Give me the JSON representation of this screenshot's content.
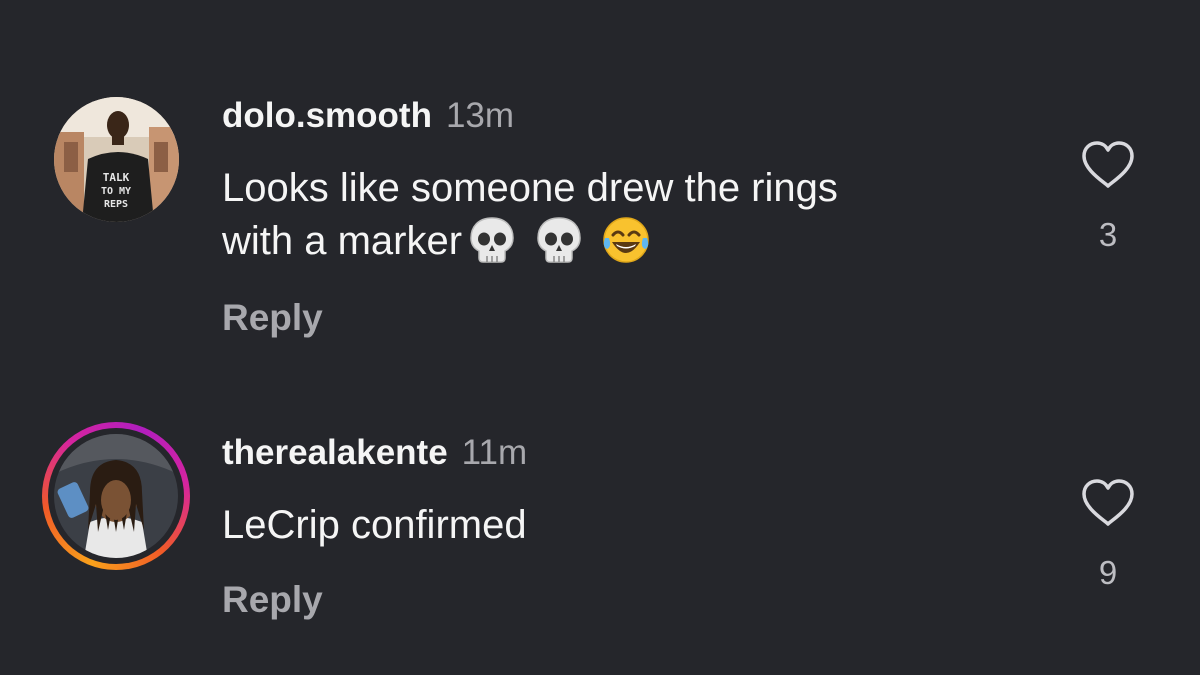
{
  "comments": [
    {
      "username": "dolo.smooth",
      "time": "13m",
      "text_line1": "Looks like someone drew the rings",
      "text_line2": "with a marker",
      "emojis": [
        "skull-emoji",
        "skull-emoji",
        "tears-of-joy-emoji"
      ],
      "reply_label": "Reply",
      "likes": "3",
      "avatar_shirt_text": [
        "TALK",
        "TO MY",
        "REPS"
      ],
      "has_story_ring": false
    },
    {
      "username": "therealakente",
      "time": "11m",
      "text": "LeCrip confirmed",
      "reply_label": "Reply",
      "likes": "9",
      "has_story_ring": true
    }
  ],
  "colors": {
    "background": "#25262b",
    "primary_text": "#f5f5f5",
    "secondary_text": "#a8a8ad",
    "story_ring": [
      "#f9a11b",
      "#d6249f",
      "#b01ebf"
    ]
  }
}
